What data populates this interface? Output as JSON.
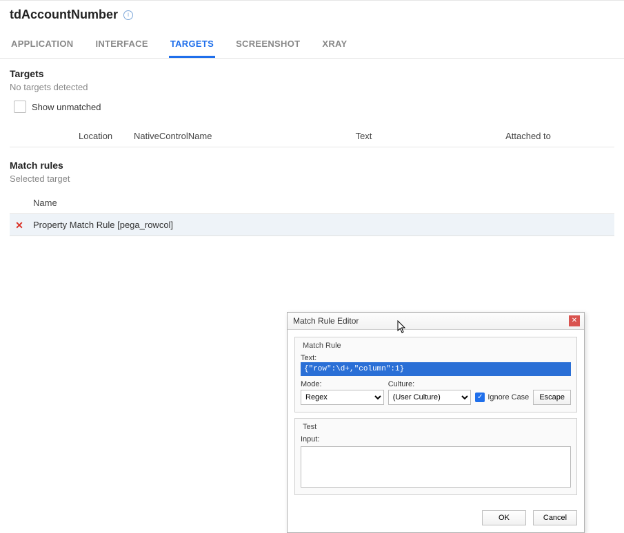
{
  "title": "tdAccountNumber",
  "tabs": [
    {
      "label": "APPLICATION",
      "active": false
    },
    {
      "label": "INTERFACE",
      "active": false
    },
    {
      "label": "TARGETS",
      "active": true
    },
    {
      "label": "SCREENSHOT",
      "active": false
    },
    {
      "label": "XRAY",
      "active": false
    }
  ],
  "targets": {
    "heading": "Targets",
    "empty_text": "No targets detected",
    "show_unmatched_label": "Show unmatched",
    "show_unmatched_checked": false,
    "columns": {
      "location": "Location",
      "native_control_name": "NativeControlName",
      "text": "Text",
      "attached_to": "Attached to"
    }
  },
  "match_rules": {
    "heading": "Match rules",
    "sub": "Selected target",
    "name_column": "Name",
    "rows": [
      {
        "status": "error",
        "label": "Property Match Rule [pega_rowcol]"
      }
    ]
  },
  "dialog": {
    "title": "Match Rule Editor",
    "group1_title": "Match Rule",
    "text_label": "Text:",
    "text_value": "{\"row\":\\d+,\"column\":1}",
    "mode_label": "Mode:",
    "mode_value": "Regex",
    "culture_label": "Culture:",
    "culture_value": "(User Culture)",
    "ignore_case_label": "Ignore Case",
    "ignore_case_checked": true,
    "escape_button": "Escape",
    "group2_title": "Test",
    "input_label": "Input:",
    "input_value": "",
    "ok": "OK",
    "cancel": "Cancel"
  }
}
